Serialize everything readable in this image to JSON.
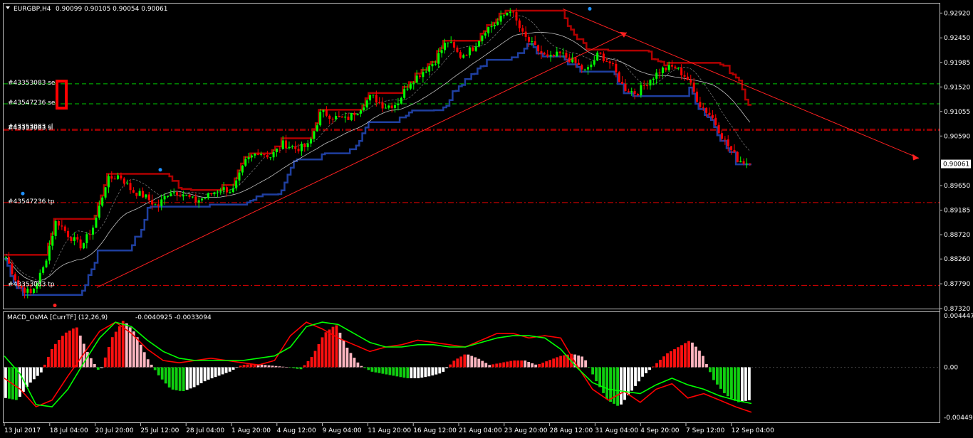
{
  "main_header": {
    "symbol": "EURGBP,H4",
    "ohlc": "0.90099 0.90105 0.90054 0.90061"
  },
  "macd_header": {
    "name": "MACD_OsMA [CurrTF] (12,26,9)",
    "values": "-0.0040925 -0.0033094"
  },
  "price_axis": {
    "labels": [
      "0.92920",
      "0.92450",
      "0.91985",
      "0.91520",
      "0.91055",
      "0.90590",
      "0.90061",
      "0.89650",
      "0.89185",
      "0.88720",
      "0.88260",
      "0.87790",
      "0.87320"
    ],
    "current_price": "0.90061"
  },
  "macd_axis": {
    "labels": [
      "0.004447",
      "0.00",
      "-0.004499"
    ]
  },
  "time_axis": {
    "labels": [
      "13 Jul 2017",
      "18 Jul 04:00",
      "20 Jul 20:00",
      "25 Jul 12:00",
      "28 Jul 04:00",
      "1 Aug 20:00",
      "4 Aug 12:00",
      "9 Aug 04:00",
      "11 Aug 20:00",
      "16 Aug 12:00",
      "21 Aug 04:00",
      "23 Aug 20:00",
      "28 Aug 12:00",
      "31 Aug 04:00",
      "4 Sep 20:00",
      "7 Sep 12:00",
      "12 Sep 04:00"
    ]
  },
  "trade_labels": [
    {
      "text": "#43353083 sell",
      "price": 0.9158
    },
    {
      "text": "#43547236 sell",
      "price": 0.912
    },
    {
      "text": "#43353083 sl",
      "price": 0.9072
    },
    {
      "text": "#43547236 tp",
      "price": 0.8933
    },
    {
      "text": "#43353083 tp",
      "price": 0.8776
    }
  ],
  "colors": {
    "bull": "#00ff00",
    "bear": "#ff0000",
    "wick": "#00ff00",
    "stop_upper": "#b00000",
    "stop_lower": "#1f3fa0",
    "ma": "#c0c0c0",
    "ma2": "#808080",
    "level_green": "#00c800",
    "level_red": "#e00000",
    "trend": "#ff2020",
    "macd_fast": "#ff0000",
    "macd_signal": "#00ff00",
    "hist_up": "#ff1010",
    "hist_up_light": "#ffb6c1",
    "hist_dn": "#10d010",
    "hist_dn_light": "#ffffff",
    "grid": "#ffffff"
  },
  "chart_data": [
    {
      "type": "candlestick",
      "title": "EURGBP,H4",
      "ylim": [
        0.8732,
        0.931
      ],
      "x_categories": [
        "13 Jul 2017",
        "18 Jul 04:00",
        "20 Jul 20:00",
        "25 Jul 12:00",
        "28 Jul 04:00",
        "1 Aug 20:00",
        "4 Aug 12:00",
        "9 Aug 04:00",
        "11 Aug 20:00",
        "16 Aug 12:00",
        "21 Aug 04:00",
        "23 Aug 20:00",
        "28 Aug 12:00",
        "31 Aug 04:00",
        "4 Sep 20:00",
        "7 Sep 12:00",
        "12 Sep 04:00"
      ],
      "close_path": [
        0.883,
        0.8775,
        0.876,
        0.881,
        0.89,
        0.887,
        0.885,
        0.889,
        0.8975,
        0.8985,
        0.8955,
        0.8945,
        0.8925,
        0.8955,
        0.895,
        0.8935,
        0.8945,
        0.896,
        0.8955,
        0.901,
        0.903,
        0.902,
        0.9045,
        0.9035,
        0.904,
        0.9105,
        0.9095,
        0.909,
        0.911,
        0.9135,
        0.9115,
        0.912,
        0.916,
        0.918,
        0.92,
        0.924,
        0.921,
        0.9225,
        0.926,
        0.9275,
        0.93,
        0.925,
        0.9225,
        0.9205,
        0.9215,
        0.92,
        0.918,
        0.9215,
        0.9195,
        0.915,
        0.914,
        0.9165,
        0.9185,
        0.919,
        0.917,
        0.912,
        0.9095,
        0.905,
        0.9015,
        0.9006
      ],
      "last_close": 0.90061
    },
    {
      "type": "histogram",
      "title": "MACD_OsMA [CurrTF] (12,26,9)",
      "ylim": [
        -0.004499,
        0.004447
      ],
      "osma": [
        -0.0028,
        -0.003,
        -0.0015,
        -0.0005,
        0.0018,
        0.003,
        0.0036,
        0.0012,
        -0.0005,
        0.0026,
        0.0042,
        0.003,
        0.0008,
        -0.0008,
        -0.002,
        -0.0022,
        -0.0018,
        -0.0012,
        -0.0008,
        -0.0004,
        0.0002,
        0.0003,
        0.0002,
        0.0001,
        0.0,
        -0.0002,
        0.001,
        0.003,
        0.0038,
        0.0016,
        0.0002,
        -0.0004,
        -0.0006,
        -0.0008,
        -0.001,
        -0.001,
        -0.0008,
        -0.0005,
        0.0006,
        0.0012,
        0.0008,
        0.0002,
        0.0004,
        0.0006,
        0.0006,
        0.0002,
        0.0006,
        0.001,
        0.0012,
        0.0009,
        -0.0012,
        -0.003,
        -0.0036,
        -0.0022,
        -0.0008,
        0.0002,
        0.0012,
        0.0018,
        0.0024,
        0.0012,
        -0.0012,
        -0.0025,
        -0.0032,
        -0.003
      ],
      "macd": [
        -0.001,
        -0.002,
        -0.0036,
        -0.003,
        -0.0008,
        0.0012,
        0.0032,
        0.004,
        0.003,
        0.0016,
        0.0006,
        0.0004,
        0.0006,
        0.0008,
        0.0006,
        0.0004,
        0.0002,
        0.0006,
        0.0028,
        0.004,
        0.0034,
        0.0026,
        0.002,
        0.0014,
        0.0018,
        0.002,
        0.0024,
        0.0022,
        0.002,
        0.0018,
        0.0024,
        0.003,
        0.003,
        0.0026,
        0.0028,
        0.0026,
        0.0002,
        -0.002,
        -0.003,
        -0.0022,
        -0.0032,
        -0.002,
        -0.0015,
        -0.0028,
        -0.0024,
        -0.003,
        -0.0036,
        -0.0041
      ],
      "signal": [
        0.001,
        -0.0006,
        -0.0034,
        -0.0036,
        -0.002,
        0.0004,
        0.0026,
        0.004,
        0.0036,
        0.0024,
        0.0014,
        0.0008,
        0.0006,
        0.0006,
        0.0006,
        0.0006,
        0.0008,
        0.001,
        0.0018,
        0.0036,
        0.004,
        0.0038,
        0.003,
        0.0022,
        0.0018,
        0.0018,
        0.002,
        0.002,
        0.0018,
        0.0018,
        0.0022,
        0.0026,
        0.0028,
        0.0028,
        0.0026,
        0.0016,
        0.0,
        -0.0014,
        -0.002,
        -0.0022,
        -0.0024,
        -0.0016,
        -0.001,
        -0.0016,
        -0.002,
        -0.0026,
        -0.003,
        -0.0033
      ]
    }
  ]
}
